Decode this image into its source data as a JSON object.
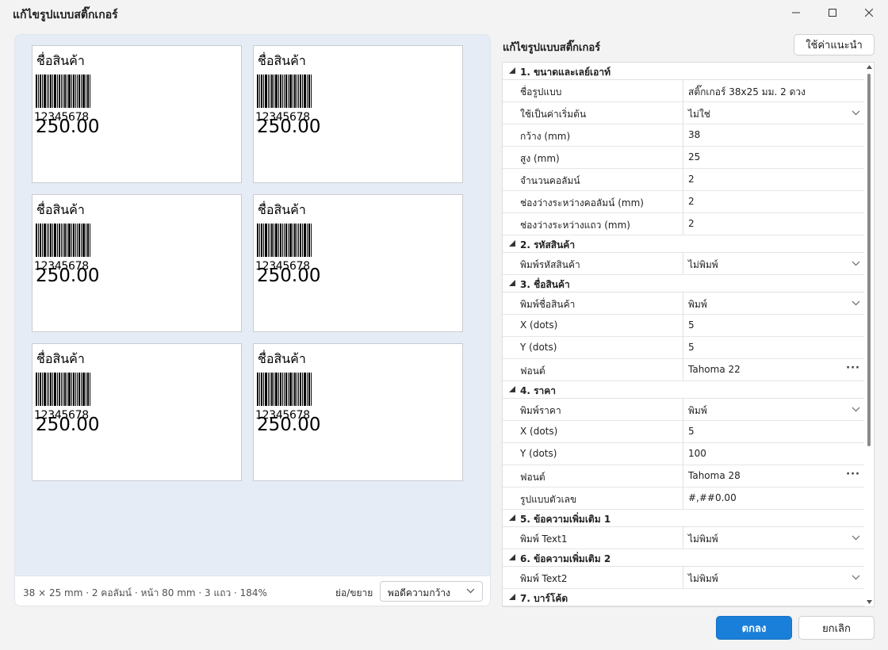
{
  "window": {
    "title": "แก้ไขรูปแบบสติ๊กเกอร์",
    "controls": [
      "minimize-icon",
      "maximize-icon",
      "close-icon"
    ]
  },
  "preview": {
    "sticker": {
      "name": "ชื่อสินค้า",
      "barcode_number": "12345678",
      "price": "250.00"
    },
    "sticker_count": 6,
    "status": "38 × 25 mm · 2 คอลัมน์ · หน้า 80 mm · 3 แถว · 184%",
    "zoom_label": "ย่อ/ขยาย",
    "zoom_value": "พอดีความกว้าง"
  },
  "properties": {
    "title": "แก้ไขรูปแบบสติ๊กเกอร์",
    "suggest_button": "ใช้ค่าแนะนำ",
    "categories": [
      {
        "label": "1. ขนาดและเลย์เอาท์",
        "rows": [
          {
            "name": "ชื่อรูปแบบ",
            "value": "สติ๊กเกอร์ 38x25 มม. 2 ดวง",
            "editor": "text"
          },
          {
            "name": "ใช้เป็นค่าเริ่มต้น",
            "value": "ไม่ใช่",
            "editor": "dropdown"
          },
          {
            "name": "กว้าง (mm)",
            "value": "38",
            "editor": "text"
          },
          {
            "name": "สูง (mm)",
            "value": "25",
            "editor": "text"
          },
          {
            "name": "จำนวนคอลัมน์",
            "value": "2",
            "editor": "text"
          },
          {
            "name": "ช่องว่างระหว่างคอลัมน์ (mm)",
            "value": "2",
            "editor": "text"
          },
          {
            "name": "ช่องว่างระหว่างแถว (mm)",
            "value": "2",
            "editor": "text"
          }
        ]
      },
      {
        "label": "2. รหัสสินค้า",
        "rows": [
          {
            "name": "พิมพ์รหัสสินค้า",
            "value": "ไม่พิมพ์",
            "editor": "dropdown"
          }
        ]
      },
      {
        "label": "3. ชื่อสินค้า",
        "rows": [
          {
            "name": "พิมพ์ชื่อสินค้า",
            "value": "พิมพ์",
            "editor": "dropdown"
          },
          {
            "name": "X (dots)",
            "value": "5",
            "editor": "text"
          },
          {
            "name": "Y (dots)",
            "value": "5",
            "editor": "text"
          },
          {
            "name": "ฟอนต์",
            "value": "Tahoma 22",
            "editor": "ellipsis"
          }
        ]
      },
      {
        "label": "4. ราคา",
        "rows": [
          {
            "name": "พิมพ์ราคา",
            "value": "พิมพ์",
            "editor": "dropdown"
          },
          {
            "name": "X (dots)",
            "value": "5",
            "editor": "text"
          },
          {
            "name": "Y (dots)",
            "value": "100",
            "editor": "text"
          },
          {
            "name": "ฟอนต์",
            "value": "Tahoma 28",
            "editor": "ellipsis"
          },
          {
            "name": "รูปแบบตัวเลข",
            "value": "#,##0.00",
            "editor": "text"
          }
        ]
      },
      {
        "label": "5. ข้อความเพิ่มเติม 1",
        "rows": [
          {
            "name": "พิมพ์ Text1",
            "value": "ไม่พิมพ์",
            "editor": "dropdown"
          }
        ]
      },
      {
        "label": "6. ข้อความเพิ่มเติม 2",
        "rows": [
          {
            "name": "พิมพ์ Text2",
            "value": "ไม่พิมพ์",
            "editor": "dropdown"
          }
        ]
      },
      {
        "label": "7. บาร์โค้ด",
        "rows": [
          {
            "name": "",
            "value": "",
            "editor": "dropdown"
          }
        ]
      }
    ]
  },
  "buttons": {
    "ok": "ตกลง",
    "cancel": "ยกเลิก"
  },
  "colors": {
    "accent": "#1a7fd8",
    "preview_bg": "#e6ecf5",
    "window_bg": "#f3f3f3"
  }
}
